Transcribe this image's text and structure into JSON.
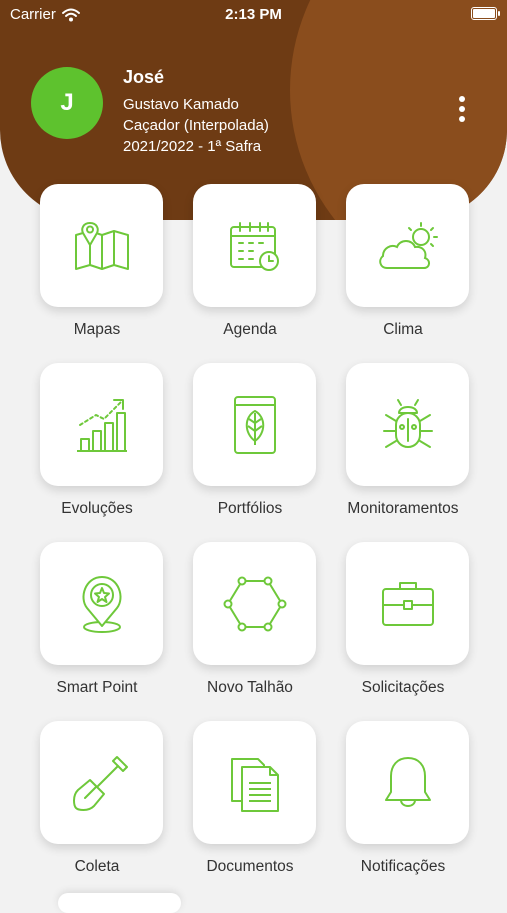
{
  "status_bar": {
    "carrier": "Carrier",
    "time": "2:13 PM"
  },
  "profile": {
    "initial": "J",
    "name": "José",
    "line1": "Gustavo Kamado",
    "line2": "Caçador (Interpolada)",
    "line3": "2021/2022 - 1ª Safra"
  },
  "colors": {
    "brand_brown": "#6e3b14",
    "accent_green": "#5ec22e",
    "icon_green": "#6ec83a"
  },
  "menu": [
    {
      "label": "Mapas",
      "icon": "map-icon"
    },
    {
      "label": "Agenda",
      "icon": "calendar-icon"
    },
    {
      "label": "Clima",
      "icon": "weather-icon"
    },
    {
      "label": "Evoluções",
      "icon": "growth-chart-icon"
    },
    {
      "label": "Portfólios",
      "icon": "leaf-book-icon"
    },
    {
      "label": "Monitoramentos",
      "icon": "bug-icon"
    },
    {
      "label": "Smart Point",
      "icon": "star-pin-icon"
    },
    {
      "label": "Novo Talhão",
      "icon": "polygon-icon"
    },
    {
      "label": "Solicitações",
      "icon": "briefcase-icon"
    },
    {
      "label": "Coleta",
      "icon": "shovel-icon"
    },
    {
      "label": "Documentos",
      "icon": "documents-icon"
    },
    {
      "label": "Notificações",
      "icon": "bell-icon"
    }
  ]
}
